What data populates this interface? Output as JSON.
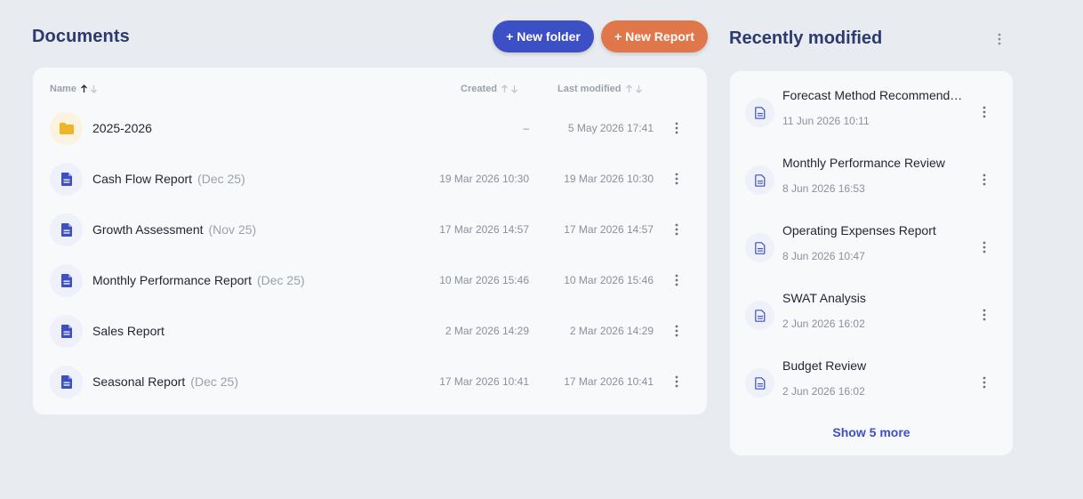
{
  "documents": {
    "title": "Documents",
    "new_folder_label": "+ New folder",
    "new_report_label": "+ New Report",
    "columns": {
      "name": "Name",
      "created": "Created",
      "last_modified": "Last modified"
    },
    "rows": [
      {
        "type": "folder",
        "name": "2025-2026",
        "tag": "",
        "created": "–",
        "modified": "5 May 2026 17:41"
      },
      {
        "type": "document",
        "name": "Cash Flow Report",
        "tag": "(Dec 25)",
        "created": "19 Mar 2026 10:30",
        "modified": "19 Mar 2026 10:30"
      },
      {
        "type": "document",
        "name": "Growth Assessment",
        "tag": "(Nov 25)",
        "created": "17 Mar 2026 14:57",
        "modified": "17 Mar 2026 14:57"
      },
      {
        "type": "document",
        "name": "Monthly Performance Report",
        "tag": "(Dec 25)",
        "created": "10 Mar 2026 15:46",
        "modified": "10 Mar 2026 15:46"
      },
      {
        "type": "document",
        "name": "Sales Report",
        "tag": "",
        "created": "2 Mar 2026 14:29",
        "modified": "2 Mar 2026 14:29"
      },
      {
        "type": "document",
        "name": "Seasonal Report",
        "tag": "(Dec 25)",
        "created": "17 Mar 2026 10:41",
        "modified": "17 Mar 2026 10:41"
      }
    ]
  },
  "recent": {
    "title": "Recently modified",
    "items": [
      {
        "title": "Forecast Method Recommend…",
        "date": "11 Jun 2026 10:11"
      },
      {
        "title": "Monthly Performance Review",
        "date": "8 Jun 2026 16:53"
      },
      {
        "title": "Operating Expenses Report",
        "date": "8 Jun 2026 10:47"
      },
      {
        "title": "SWAT Analysis",
        "date": "2 Jun 2026 16:02"
      },
      {
        "title": "Budget Review",
        "date": "2 Jun 2026 16:02"
      }
    ],
    "show_more_label": "Show 5 more"
  },
  "colors": {
    "primary": "#3d4fc4",
    "accent": "#e0774a",
    "folder": "#f0b429",
    "heading": "#2b3a70"
  },
  "icons": {
    "folder": "folder-icon",
    "document": "document-icon",
    "more": "more-vertical-icon",
    "sort_up": "arrow-up-icon",
    "sort_down": "arrow-down-icon"
  }
}
